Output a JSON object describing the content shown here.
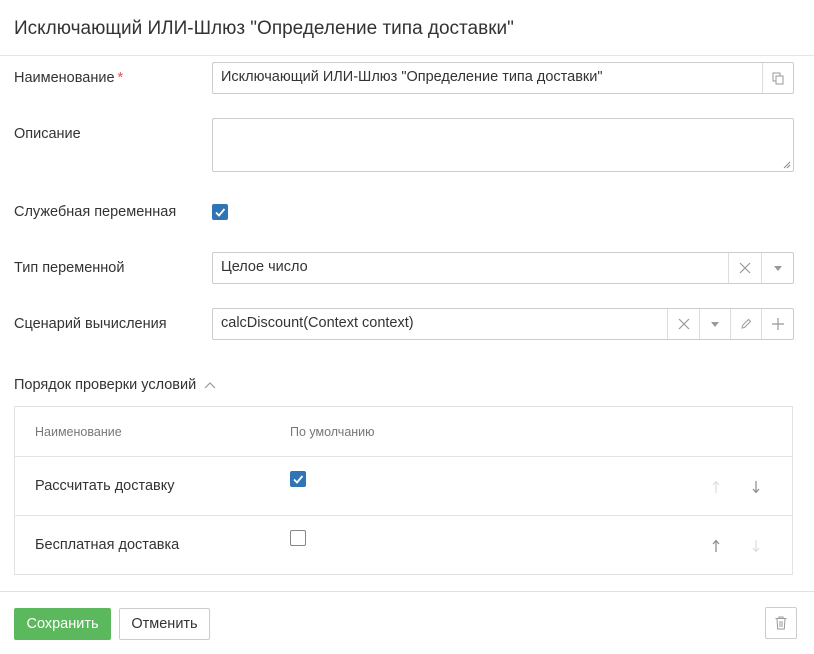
{
  "dialog": {
    "title": "Исключающий ИЛИ-Шлюз \"Определение типа доставки\""
  },
  "form": {
    "name": {
      "label": "Наименование",
      "required_mark": "*",
      "value": "Исключающий ИЛИ-Шлюз \"Определение типа доставки\"",
      "copy_icon": "copy-icon"
    },
    "description": {
      "label": "Описание",
      "value": ""
    },
    "service_variable": {
      "label": "Служебная переменная",
      "checked": true
    },
    "variable_type": {
      "label": "Тип переменной",
      "value": "Целое число"
    },
    "calc_script": {
      "label": "Сценарий вычисления",
      "value": "calcDiscount(Context context)"
    }
  },
  "conditions": {
    "title": "Порядок проверки условий",
    "expanded": true,
    "columns": [
      "Наименование",
      "По умолчанию"
    ],
    "rows": [
      {
        "name": "Рассчитать доставку",
        "default": true,
        "up_enabled": false,
        "down_enabled": true
      },
      {
        "name": "Бесплатная доставка",
        "default": false,
        "up_enabled": true,
        "down_enabled": false
      }
    ]
  },
  "footer": {
    "save_label": "Сохранить",
    "cancel_label": "Отменить",
    "delete_icon": "trash-icon"
  },
  "colors": {
    "accent": "#2f74b5",
    "save": "#5cb85c",
    "required": "#d9534f"
  }
}
